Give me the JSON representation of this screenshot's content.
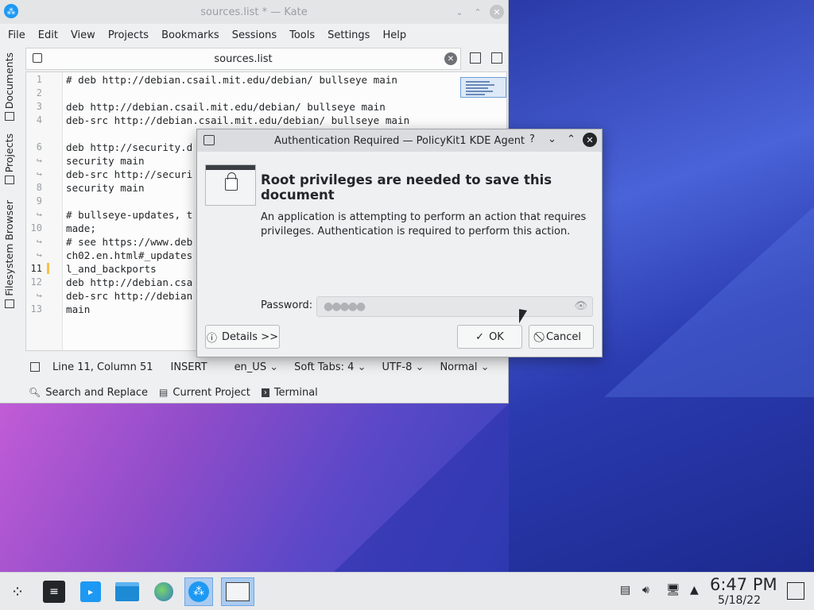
{
  "kate": {
    "title": "sources.list * — Kate",
    "menu": [
      "File",
      "Edit",
      "View",
      "Projects",
      "Bookmarks",
      "Sessions",
      "Tools",
      "Settings",
      "Help"
    ],
    "sidebar": [
      "Documents",
      "Projects",
      "Filesystem Browser"
    ],
    "tab_title": "sources.list",
    "line_numbers": [
      "1",
      "2",
      "3",
      "4",
      "",
      "6",
      "",
      "",
      "8",
      "9",
      "",
      "10",
      "",
      "",
      "11",
      "12",
      "",
      "13"
    ],
    "lines": [
      "# deb http://debian.csail.mit.edu/debian/ bullseye main",
      "",
      "deb http://debian.csail.mit.edu/debian/ bullseye main",
      "deb-src http://debian.csail.mit.edu/debian/ bullseye main",
      "",
      "deb http://security.d",
      "security main",
      "deb-src http://securi",
      "security main",
      "",
      "# bullseye-updates, t",
      "made;",
      "# see https://www.deb",
      "ch02.en.html#_updates",
      "l_and_backports",
      "deb http://debian.csa",
      "deb-src http://debian",
      "main"
    ],
    "status": {
      "position": "Line 11, Column 51",
      "mode": "INSERT",
      "lang": "en_US",
      "tabs": "Soft Tabs: 4",
      "encoding": "UTF-8",
      "highlight": "Normal"
    },
    "bottom_tools": [
      "Search and Replace",
      "Current Project",
      "Terminal"
    ]
  },
  "dialog": {
    "title": "Authentication Required — PolicyKit1 KDE Agent",
    "help": "?",
    "heading": "Root privileges are needed to save this document",
    "description": "An application is attempting to perform an action that requires privileges. Authentication is required to perform this action.",
    "password_label": "Password:",
    "password_mask": "●●●●●",
    "details_button": "Details >>",
    "ok_button": "OK",
    "cancel_button": "Cancel"
  },
  "taskbar": {
    "time": "6:47 PM",
    "date": "5/18/22"
  }
}
